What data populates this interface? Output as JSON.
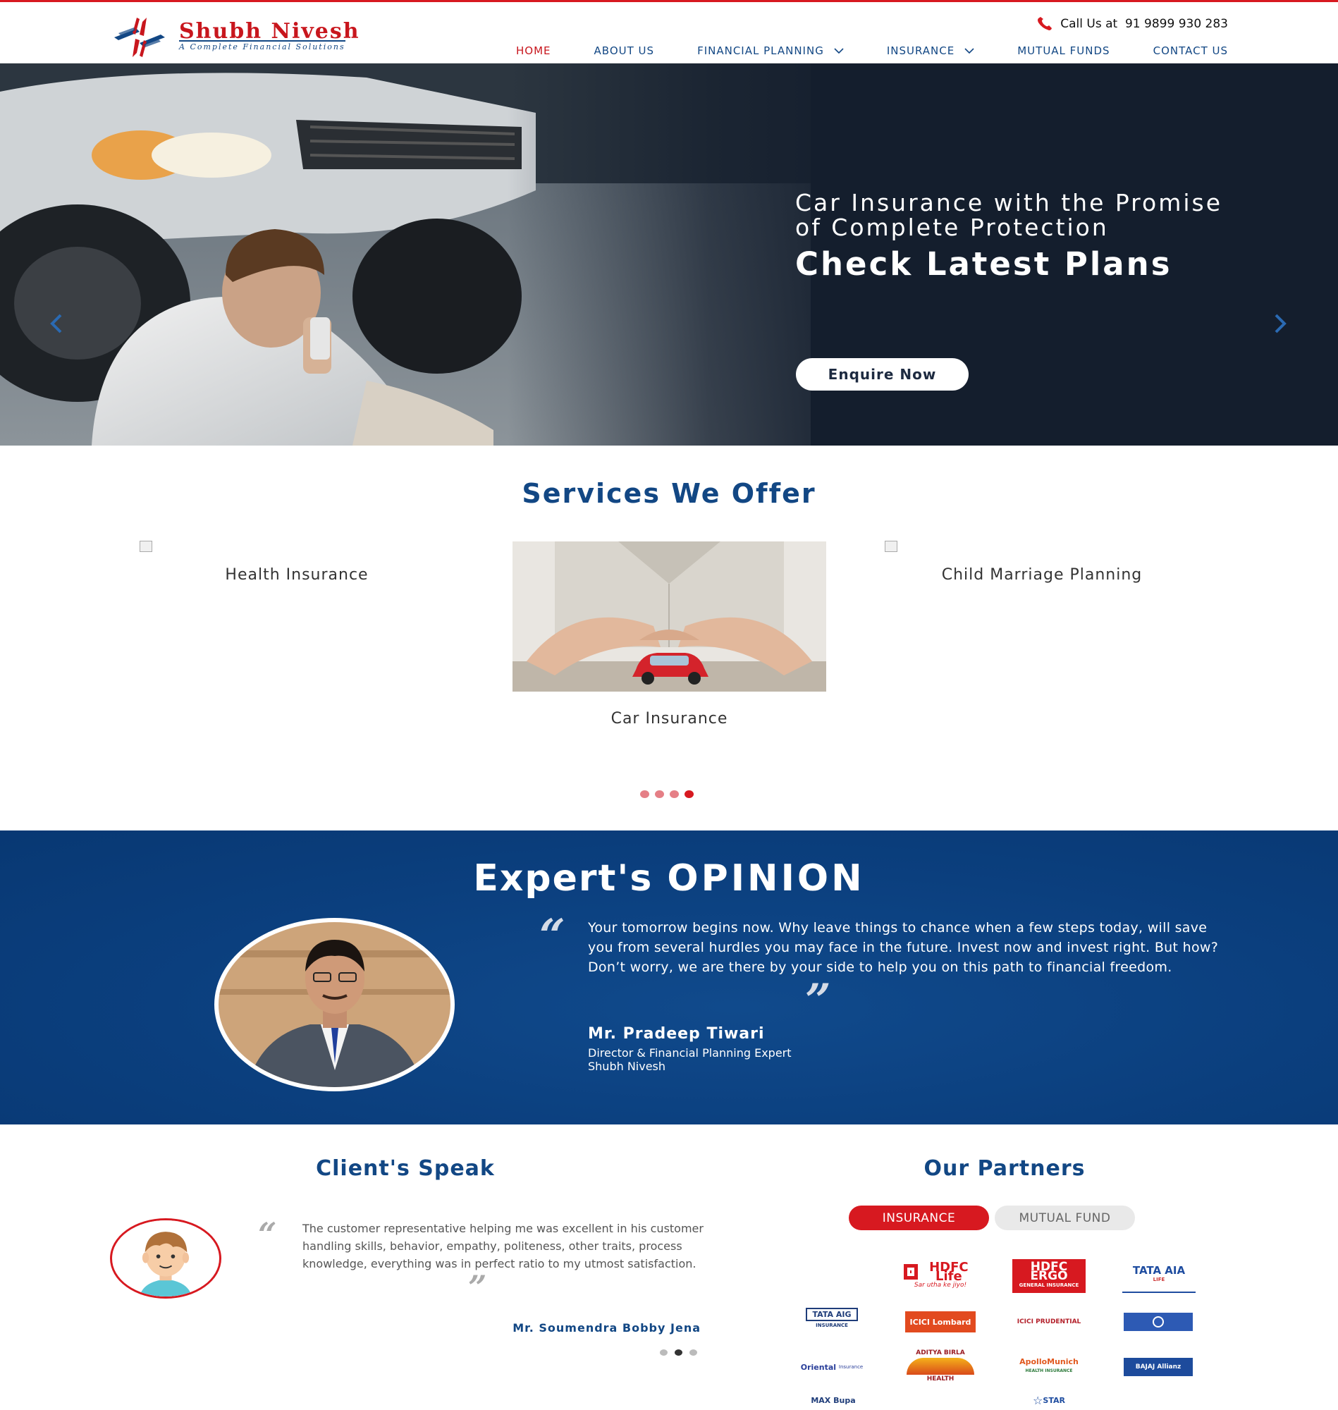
{
  "header": {
    "logo": {
      "name": "Shubh Nivesh",
      "tagline": "A Complete Financial Solutions"
    },
    "call": {
      "label": "Call Us at",
      "number": "91 9899 930 283",
      "icon": "phone-icon"
    },
    "nav": [
      {
        "label": "HOME",
        "active": true,
        "dropdown": false
      },
      {
        "label": "ABOUT US",
        "active": false,
        "dropdown": false
      },
      {
        "label": "FINANCIAL PLANNING",
        "active": false,
        "dropdown": true
      },
      {
        "label": "INSURANCE",
        "active": false,
        "dropdown": true
      },
      {
        "label": "MUTUAL FUNDS",
        "active": false,
        "dropdown": false
      },
      {
        "label": "CONTACT US",
        "active": false,
        "dropdown": false
      }
    ]
  },
  "hero": {
    "subtitle_line1": "Car Insurance with the Promise",
    "subtitle_line2": "of Complete Protection",
    "title": "Check Latest Plans",
    "button": "Enquire Now",
    "prev_icon": "chevron-left-icon",
    "next_icon": "chevron-right-icon"
  },
  "services": {
    "title": "Services We Offer",
    "items": [
      {
        "label": "Health Insurance"
      },
      {
        "label": "Car Insurance"
      },
      {
        "label": "Child Marriage Planning"
      }
    ],
    "dots": 4,
    "active_dot": 3
  },
  "expert": {
    "title_light": "Expert's",
    "title_bold": "OPINION",
    "quote": "Your tomorrow begins now. Why leave things to chance when a few steps today, will save you from several hurdles you may face in the future. Invest now and invest right. But how? Don’t worry, we are there by your side to help you on this path to financial freedom.",
    "name": "Mr. Pradeep Tiwari",
    "role": "Director & Financial Planning Expert",
    "company": "Shubh Nivesh"
  },
  "clients": {
    "title": "Client's Speak",
    "quote": "The customer representative helping me was excellent in his customer handling skills, behavior, empathy, politeness, other traits, process knowledge, everything was in perfect ratio to my utmost satisfaction.",
    "name": "Mr. Soumendra Bobby Jena",
    "dots": 3,
    "active_dot": 1
  },
  "partners": {
    "title": "Our Partners",
    "tabs": [
      {
        "label": "INSURANCE",
        "active": true
      },
      {
        "label": "MUTUAL FUND",
        "active": false
      }
    ],
    "logos": [
      {
        "name": "HDFC Life",
        "tag": "Sar utha ke jiyo!"
      },
      {
        "name": "HDFC ERGO",
        "tag": "GENERAL INSURANCE"
      },
      {
        "name": "TATA AIA",
        "tag": "LIFE"
      },
      {
        "name": "TATA AIG",
        "tag": "INSURANCE"
      },
      {
        "name": "ICICI Lombard",
        "tag": ""
      },
      {
        "name": "ICICI PRUDENTIAL",
        "tag": ""
      },
      {
        "name": "",
        "tag": ""
      },
      {
        "name": "Oriental",
        "tag": "Insurance"
      },
      {
        "name": "ADITYA BIRLA",
        "tag": "HEALTH"
      },
      {
        "name": "ApolloMunich",
        "tag": "HEALTH INSURANCE"
      },
      {
        "name": "BAJAJ Allianz",
        "tag": ""
      },
      {
        "name": "MAX Bupa",
        "tag": ""
      },
      {
        "name": "STAR",
        "tag": ""
      }
    ]
  },
  "colors": {
    "brand_red": "#d71920",
    "brand_blue": "#124784",
    "hero_bg": "#141e2d",
    "expert_bg": "#0b3f7e"
  }
}
